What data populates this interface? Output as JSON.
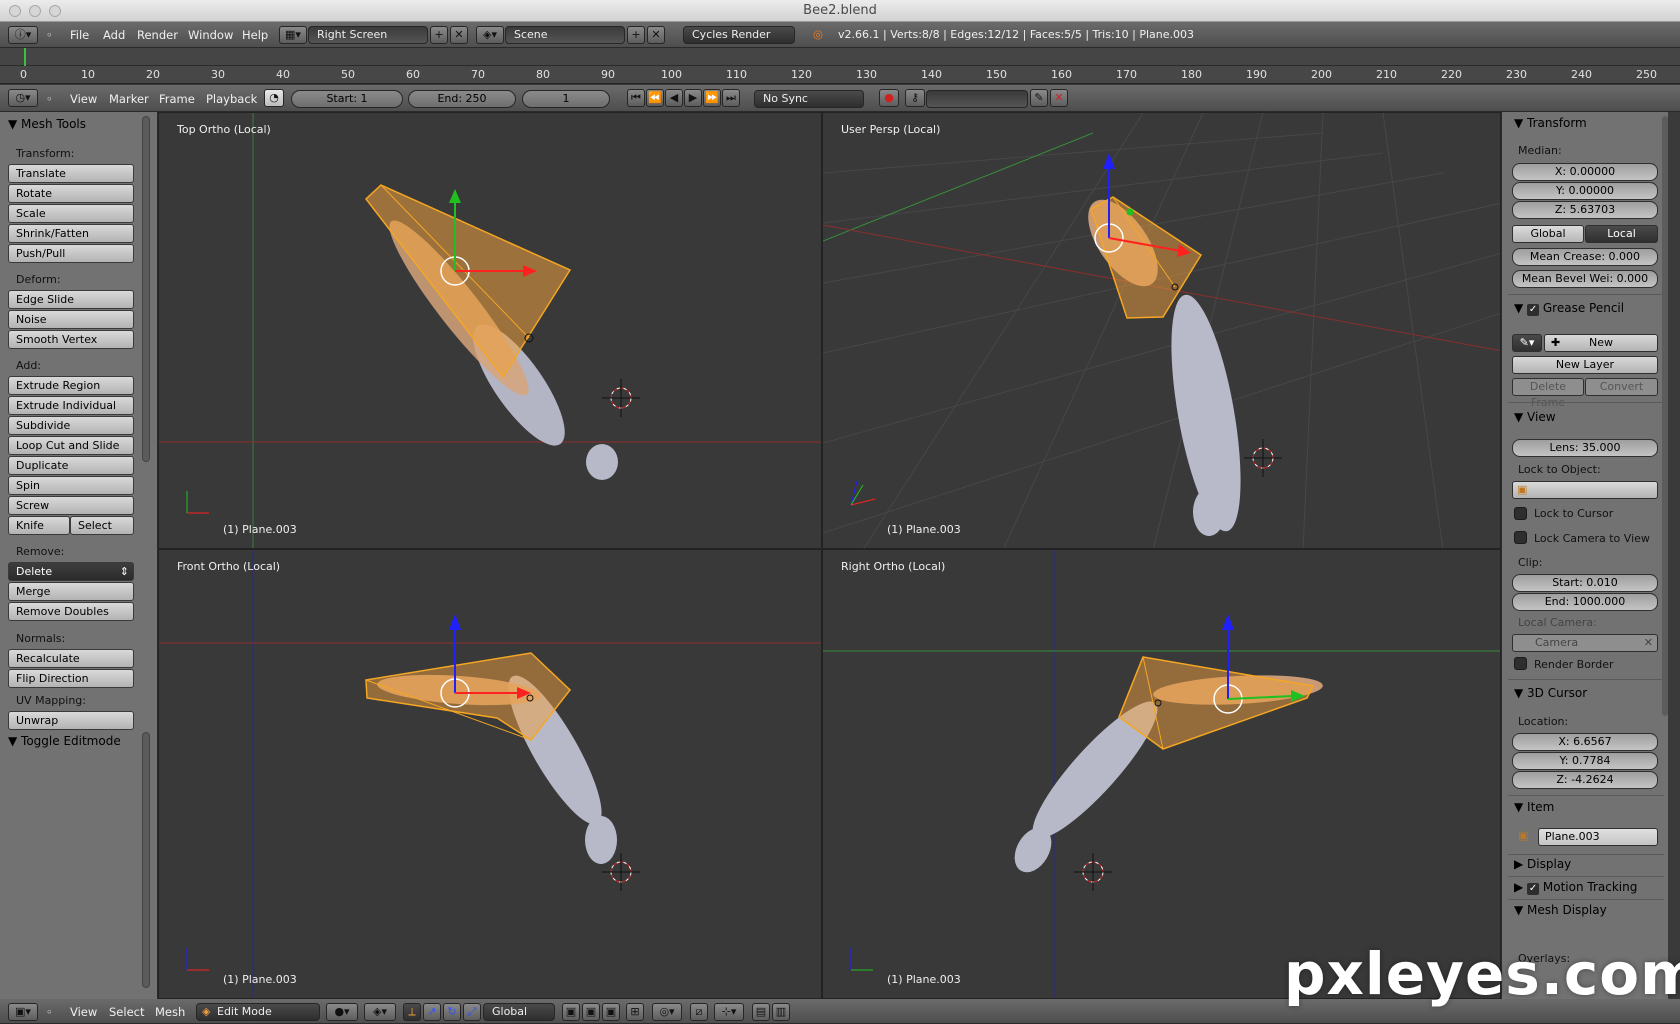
{
  "window": {
    "title": "Bee2.blend"
  },
  "menubar": {
    "items": [
      "File",
      "Add",
      "Render",
      "Window",
      "Help"
    ],
    "screen": "Right Screen",
    "scene": "Scene",
    "engine": "Cycles Render",
    "stats": "v2.66.1 | Verts:8/8 | Edges:12/12 | Faces:5/5 | Tris:10 | Plane.003"
  },
  "timeline": {
    "ticks": [
      "0",
      "10",
      "20",
      "30",
      "40",
      "50",
      "60",
      "70",
      "80",
      "90",
      "100",
      "110",
      "120",
      "130",
      "140",
      "150",
      "160",
      "170",
      "180",
      "190",
      "200",
      "210",
      "220",
      "230",
      "240",
      "250"
    ],
    "menu": [
      "View",
      "Marker",
      "Frame",
      "Playback"
    ],
    "start": "Start: 1",
    "end": "End: 250",
    "current": "1",
    "sync": "No Sync"
  },
  "toolshelf": {
    "title": "Mesh Tools",
    "transform_label": "Transform:",
    "transform": [
      "Translate",
      "Rotate",
      "Scale",
      "Shrink/Fatten",
      "Push/Pull"
    ],
    "deform_label": "Deform:",
    "deform": [
      "Edge Slide",
      "Noise",
      "Smooth Vertex"
    ],
    "add_label": "Add:",
    "add": [
      "Extrude Region",
      "Extrude Individual",
      "Subdivide",
      "Loop Cut and Slide",
      "Duplicate",
      "Spin",
      "Screw"
    ],
    "knife": "Knife",
    "select": "Select",
    "remove_label": "Remove:",
    "delete": "Delete",
    "remove": [
      "Merge",
      "Remove Doubles"
    ],
    "normals_label": "Normals:",
    "normals": [
      "Recalculate",
      "Flip Direction"
    ],
    "uv_label": "UV Mapping:",
    "unwrap": "Unwrap",
    "toggle": "Toggle Editmode"
  },
  "viewports": {
    "top": "Top Ortho (Local)",
    "persp": "User Persp (Local)",
    "front": "Front Ortho (Local)",
    "right": "Right Ortho (Local)",
    "object": "(1) Plane.003"
  },
  "properties": {
    "transform_title": "Transform",
    "median_label": "Median:",
    "x": "X: 0.00000",
    "y": "Y: 0.00000",
    "z": "Z: 5.63703",
    "global": "Global",
    "local": "Local",
    "mean_crease": "Mean Crease: 0.000",
    "mean_bevel": "Mean Bevel Wei: 0.000",
    "grease_title": "Grease Pencil",
    "gp_new": "New",
    "gp_new_layer": "New Layer",
    "gp_delete_frame": "Delete Frame",
    "gp_convert": "Convert",
    "view_title": "View",
    "lens": "Lens: 35.000",
    "lock_obj_label": "Lock to Object:",
    "lock_cursor": "Lock to Cursor",
    "lock_camera": "Lock Camera to View",
    "clip_label": "Clip:",
    "clip_start": "Start: 0.010",
    "clip_end": "End: 1000.000",
    "local_camera_label": "Local Camera:",
    "camera": "Camera",
    "render_border": "Render Border",
    "cursor_title": "3D Cursor",
    "location_label": "Location:",
    "cx": "X: 6.6567",
    "cy": "Y: 0.7784",
    "cz": "Z: -4.2624",
    "item_title": "Item",
    "item_name": "Plane.003",
    "display_title": "Display",
    "motion_tracking": "Motion Tracking",
    "mesh_display": "Mesh Display",
    "overlays": "Overlays:"
  },
  "statusbar": {
    "menu": [
      "View",
      "Select",
      "Mesh"
    ],
    "mode": "Edit Mode",
    "orientation": "Global"
  },
  "watermark": "pxleyes.com",
  "colors": {
    "selection": "#f5a623",
    "mesh": "#c8c9d6",
    "x_axis": "#ff2020",
    "y_axis": "#20c020",
    "z_axis": "#2020ff"
  }
}
